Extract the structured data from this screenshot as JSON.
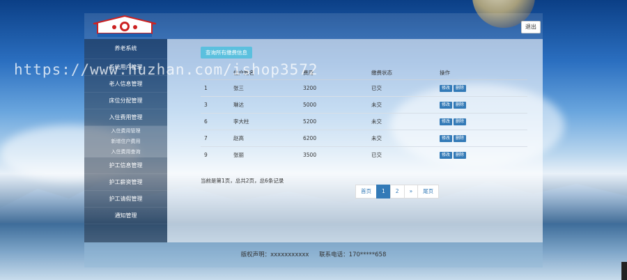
{
  "header": {
    "logout_label": "退出"
  },
  "sidebar": {
    "items": [
      {
        "label": "养老系统"
      },
      {
        "label": "系统用户管理"
      },
      {
        "label": "老人信息管理"
      },
      {
        "label": "床位分配管理"
      },
      {
        "label": "入住费用管理"
      }
    ],
    "subitems": [
      "入住费用管理",
      "新增住户费用",
      "入住费用查询"
    ],
    "items2": [
      {
        "label": "护工信息管理"
      },
      {
        "label": "护工薪资管理"
      },
      {
        "label": "护工请假管理"
      },
      {
        "label": "通知管理"
      }
    ]
  },
  "main": {
    "query_button": "查询所有缴费信息",
    "columns": [
      "",
      "住户姓名",
      "费用",
      "缴费状态",
      "操作"
    ],
    "rows": [
      {
        "id": "1",
        "name": "张三",
        "fee": "3200",
        "status": "已交"
      },
      {
        "id": "3",
        "name": "琳达",
        "fee": "5000",
        "status": "未交"
      },
      {
        "id": "6",
        "name": "李大柱",
        "fee": "5200",
        "status": "未交"
      },
      {
        "id": "7",
        "name": "赵高",
        "fee": "6200",
        "status": "未交"
      },
      {
        "id": "9",
        "name": "张丽",
        "fee": "3500",
        "status": "已交"
      }
    ],
    "edit_label": "修改",
    "delete_label": "删除",
    "summary": "当前是第1页，总共2页，总6条记录",
    "pager": [
      "首页",
      "1",
      "2",
      "»",
      "尾页"
    ]
  },
  "footer": {
    "copyright": "版权声明：xxxxxxxxxxx",
    "phone": "联系电话：170*****658"
  },
  "watermark": "https://www.huzhan.com/ishop3572",
  "colors": {
    "primary": "#337ab7",
    "info": "#5bc0de"
  }
}
